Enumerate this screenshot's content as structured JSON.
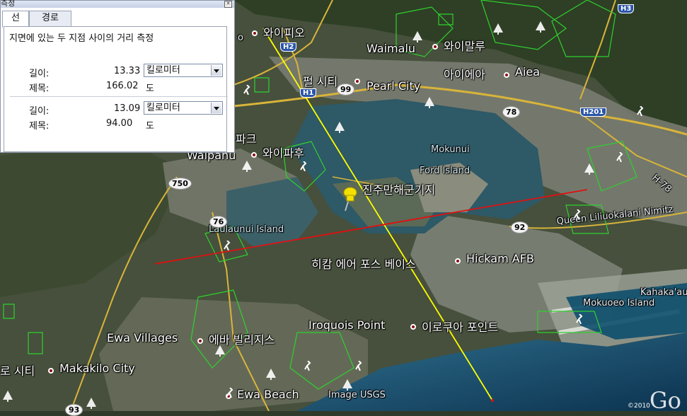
{
  "panel": {
    "title": "측정",
    "tabs": [
      {
        "label": "선"
      },
      {
        "label": "경로"
      }
    ],
    "description": "지면에 있는 두 지점 사이의 거리 측정",
    "measurements": [
      {
        "length_label": "길이:",
        "length_value": "13.33",
        "unit": "킬로미터",
        "heading_label": "제목:",
        "heading_value": "166.02",
        "heading_unit": "도"
      },
      {
        "length_label": "길이:",
        "length_value": "13.09",
        "unit": "킬로미터",
        "heading_label": "제목:",
        "heading_value": "94.00",
        "heading_unit": "도"
      }
    ]
  },
  "map": {
    "places": [
      {
        "label": "와이피오"
      },
      {
        "label": "Waimalu"
      },
      {
        "label": "와이말루"
      },
      {
        "label": "아이에아"
      },
      {
        "label": "Aiea"
      },
      {
        "label": "펄 시티"
      },
      {
        "label": "Pearl City"
      },
      {
        "label": "파크"
      },
      {
        "label": "Waipahu"
      },
      {
        "label": "와이파후"
      },
      {
        "label": "진주만해군기지"
      },
      {
        "label": "Mokunui"
      },
      {
        "label": "Ford Island"
      },
      {
        "label": "Laulaunui Island"
      },
      {
        "label": "히캄 에어 포스 베이스"
      },
      {
        "label": "Hickam AFB"
      },
      {
        "label": "Queen Liliuokalani Nimitz"
      },
      {
        "label": "Kahaka'au"
      },
      {
        "label": "Mokuoeo Island"
      },
      {
        "label": "Iroquois Point"
      },
      {
        "label": "이로쿠아 포인트"
      },
      {
        "label": "Ewa Villages"
      },
      {
        "label": "에바 빌리지스"
      },
      {
        "label": "로 시티"
      },
      {
        "label": "Makakilo City"
      },
      {
        "label": "Ewa Beach"
      },
      {
        "label": "Image USGS"
      }
    ],
    "roads": {
      "h1": "H1",
      "h2": "H2",
      "h3": "H3",
      "h201": "H201",
      "h78": "H-78",
      "r99": "99",
      "r78": "78",
      "r750": "750",
      "r76": "76",
      "r92": "92",
      "r93": "93"
    },
    "copyright": "©2010",
    "logo": "Go",
    "colors": {
      "measure_line_1": "#ffff00",
      "measure_line_2": "#e01010",
      "park_outline": "#2fd02f",
      "highway": "#d8b43a"
    }
  }
}
